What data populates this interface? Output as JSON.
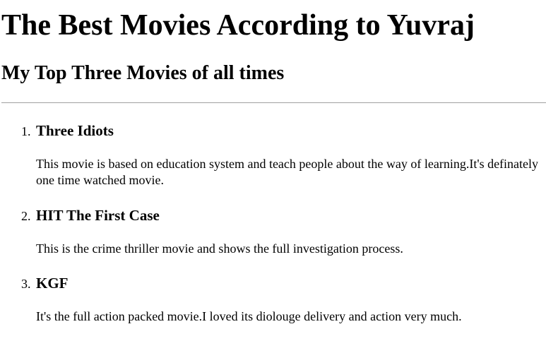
{
  "page": {
    "title": "The Best Movies According to Yuvraj",
    "subtitle": "My Top Three Movies of all times"
  },
  "movies": [
    {
      "number": "1.",
      "title": "Three Idiots",
      "description": "This movie is based on education system and teach people about the way of learning.It's definately one time watched movie."
    },
    {
      "number": "2.",
      "title": "HIT The First Case",
      "description": "This is the crime thriller movie and shows the full investigation process."
    },
    {
      "number": "3.",
      "title": "KGF",
      "description": "It's the full action packed movie.I loved its diolouge delivery and action very much."
    }
  ]
}
